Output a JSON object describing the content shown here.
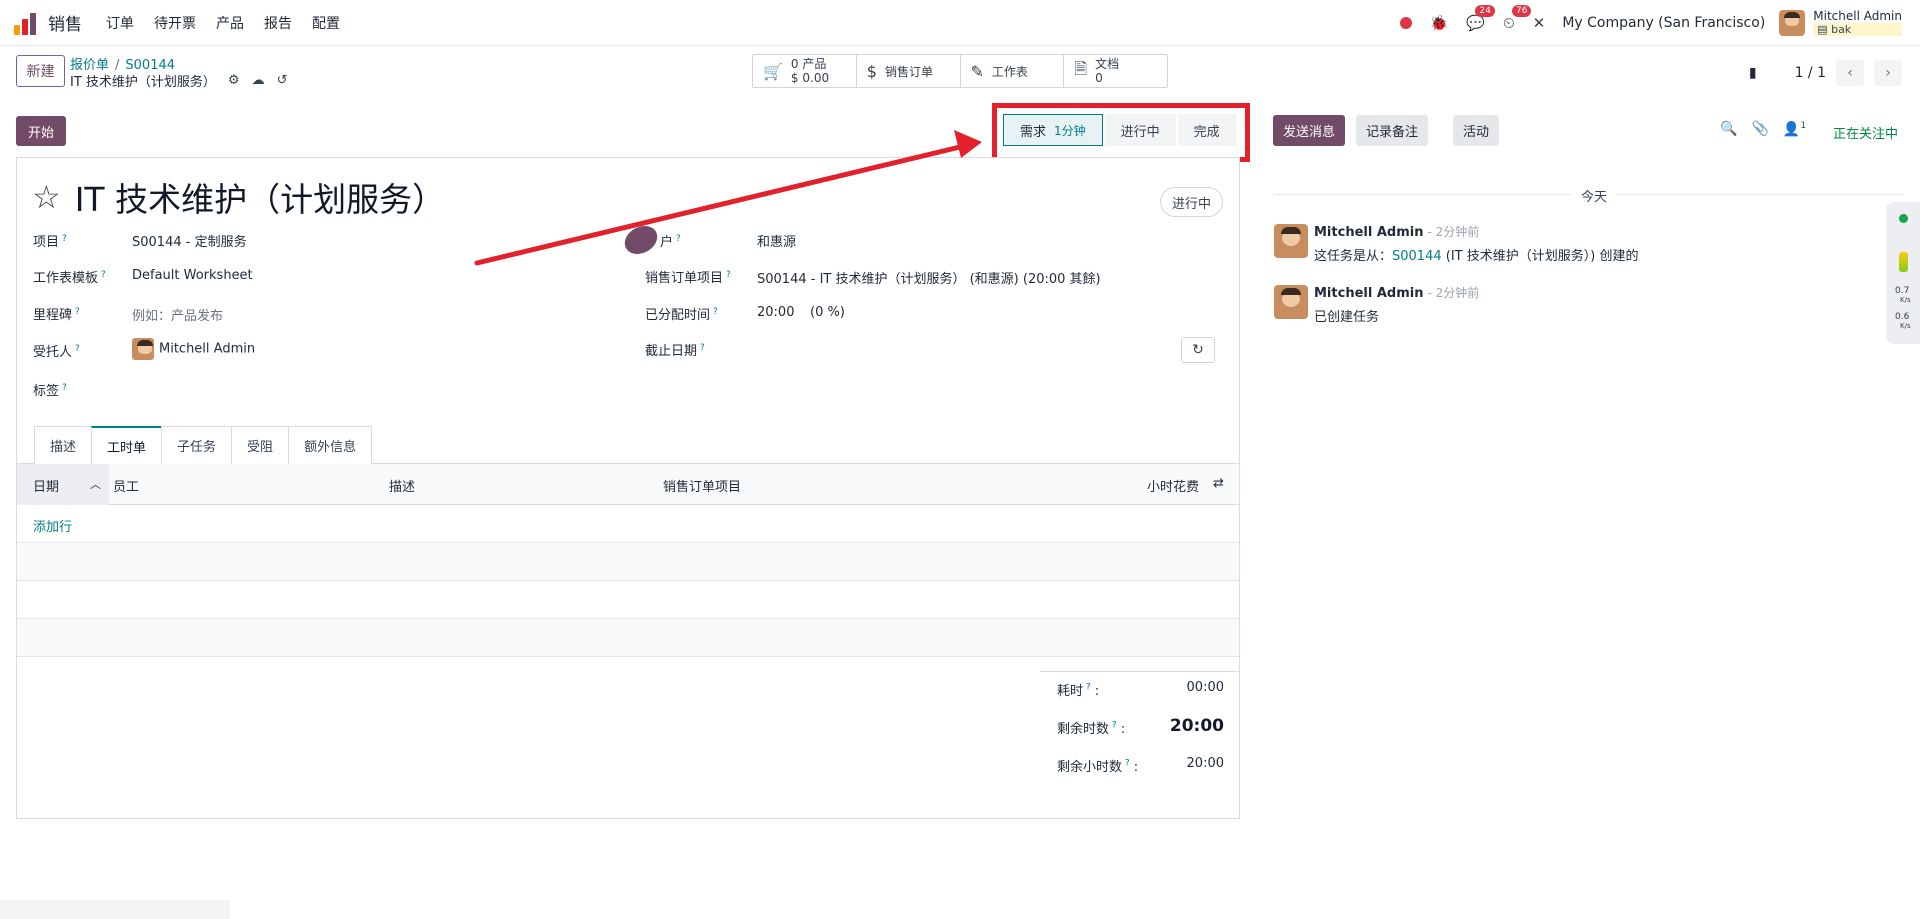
{
  "nav": {
    "app_name": "销售",
    "menu": [
      "订单",
      "待开票",
      "产品",
      "报告",
      "配置"
    ],
    "messages_count": "24",
    "activities_count": "76",
    "company": "My Company (San Francisco)",
    "user_name": "Mitchell Admin",
    "db_name": "bak"
  },
  "control": {
    "new_label": "新建",
    "breadcrumb_parent": "报价单",
    "breadcrumb_order": "S00144",
    "record_name": "IT 技术维护（计划服务）",
    "smart_buttons": {
      "products_count": "0 产品",
      "products_amount": "$ 0.00",
      "sales_order": "销售订单",
      "worksheet": "工作表",
      "docs_label": "文档",
      "docs_count": "0"
    },
    "pager": "1 / 1"
  },
  "form": {
    "start_label": "开始",
    "stages": [
      {
        "label": "需求",
        "duration": "1分钟"
      },
      {
        "label": "进行中"
      },
      {
        "label": "完成"
      }
    ],
    "title": "IT 技术维护（计划服务）",
    "status": "进行中",
    "fields": {
      "project_label": "项目",
      "project_value": "S00144 - 定制服务",
      "template_label": "工作表模板",
      "template_value": "Default Worksheet",
      "milestone_label": "里程碑",
      "milestone_placeholder": "例如：产品发布",
      "assignee_label": "受托人",
      "assignee_value": "Mitchell Admin",
      "tags_label": "标签",
      "customer_label": "户",
      "customer_value": "和惠源",
      "so_item_label": "销售订单项目",
      "so_item_value": "S00144 - IT 技术维护（计划服务） (和惠源) (20:00 其餘)",
      "allocated_label": "已分配时间",
      "allocated_value": "20:00",
      "allocated_percent": "(0 %)",
      "deadline_label": "截止日期"
    },
    "tabs": [
      "描述",
      "工时单",
      "子任务",
      "受阻",
      "额外信息"
    ],
    "active_tab": "工时单",
    "columns": {
      "date": "日期",
      "employee": "员工",
      "description": "描述",
      "so_item": "销售订单项目",
      "hours": "小时花费"
    },
    "add_line": "添加行",
    "totals": {
      "spent_label": "耗时",
      "spent_value": "00:00",
      "remaining_label": "剩余时数",
      "remaining_value": "20:00",
      "remaining_hours_label": "剩余小时数",
      "remaining_hours_value": "20:00"
    }
  },
  "chatter": {
    "send_message": "发送消息",
    "log_note": "记录备注",
    "activity": "活动",
    "followers_count": "1",
    "following": "正在关注中",
    "today": "今天",
    "messages": [
      {
        "author": "Mitchell Admin",
        "time": "- 2分钟前",
        "prefix": "这任务是从：",
        "link": "S00144",
        "suffix": "(IT 技术维护（计划服务）) 创建的"
      },
      {
        "author": "Mitchell Admin",
        "time": "- 2分钟前",
        "body": "已创建任务"
      }
    ]
  },
  "widget": {
    "up": "0.7",
    "down": "0.6",
    "unit": "K/s"
  },
  "colors": {
    "brand": "#714b67",
    "accent": "#017e84",
    "highlight": "#e3212b",
    "following": "#008a3e"
  }
}
